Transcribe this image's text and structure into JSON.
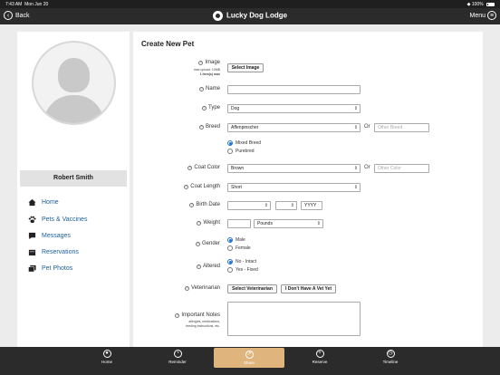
{
  "status_bar": {
    "time": "7:43 AM",
    "date": "Mon Jun 20",
    "battery": "100%"
  },
  "navbar": {
    "back_label": "Back",
    "title": "Lucky Dog Lodge",
    "menu_label": "Menu"
  },
  "sidebar": {
    "user_name": "Robert Smith",
    "items": [
      {
        "label": "Home",
        "icon": "house-icon"
      },
      {
        "label": "Pets & Vaccines",
        "icon": "paw-icon"
      },
      {
        "label": "Messages",
        "icon": "chat-icon"
      },
      {
        "label": "Reservations",
        "icon": "calendar-icon"
      },
      {
        "label": "Pet Photos",
        "icon": "photos-icon"
      }
    ]
  },
  "form": {
    "title": "Create New Pet",
    "image": {
      "label": "Image",
      "note_line1": "max upload: 10MB",
      "note_line2": "1 item(s) max",
      "button": "Select Image"
    },
    "name": {
      "label": "Name",
      "value": ""
    },
    "type": {
      "label": "Type",
      "value": "Dog"
    },
    "breed": {
      "label": "Breed",
      "value": "Affenpinscher",
      "or": "Or",
      "other_placeholder": "Other Breed",
      "options": [
        "Mixed Breed",
        "Purebred"
      ],
      "selected": "Mixed Breed"
    },
    "coat_color": {
      "label": "Coat Color",
      "value": "Brown",
      "or": "Or",
      "other_placeholder": "Other Color"
    },
    "coat_length": {
      "label": "Coat Length",
      "value": "Short"
    },
    "birth_date": {
      "label": "Birth Date",
      "month": "",
      "day": "",
      "year_placeholder": "YYYY"
    },
    "weight": {
      "label": "Weight",
      "value": "",
      "unit": "Pounds"
    },
    "gender": {
      "label": "Gender",
      "options": [
        "Male",
        "Female"
      ],
      "selected": "Male"
    },
    "altered": {
      "label": "Altered",
      "options": [
        "No - Intact",
        "Yes - Fixed"
      ],
      "selected": "No - Intact"
    },
    "veterinarian": {
      "label": "Veterinarian",
      "select_button": "Select Veterinarian",
      "no_vet_button": "I Don't Have A Vet Yet"
    },
    "important_notes": {
      "label": "Important Notes",
      "note_line1": "allergies, medications,",
      "note_line2": "feeding instructions, etc."
    }
  },
  "tabbar": {
    "active": "Share",
    "items": [
      {
        "label": "Home",
        "icon": "person-circle-icon"
      },
      {
        "label": "Reminder",
        "icon": "bell-icon"
      },
      {
        "label": "Share",
        "icon": "share-icon"
      },
      {
        "label": "Reserve",
        "icon": "plus-circle-icon"
      },
      {
        "label": "Timeline",
        "icon": "timeline-icon"
      }
    ]
  }
}
